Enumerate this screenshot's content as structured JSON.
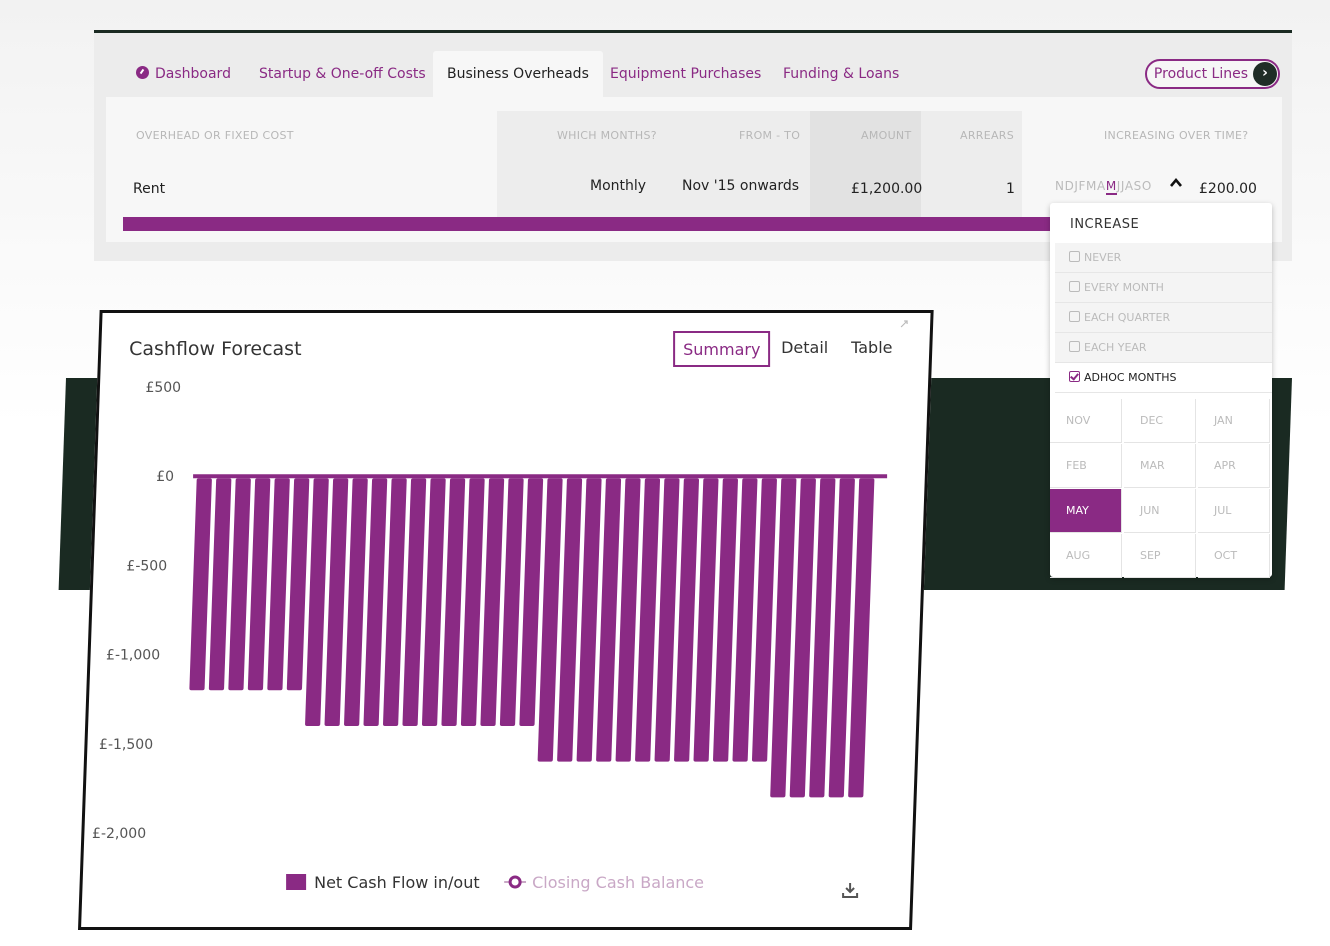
{
  "tabs": [
    {
      "label": "Dashboard",
      "icon": "dashboard-icon"
    },
    {
      "label": "Startup & One-off Costs"
    },
    {
      "label": "Business Overheads",
      "active": true
    },
    {
      "label": "Equipment Purchases"
    },
    {
      "label": "Funding & Loans"
    }
  ],
  "product_lines_label": "Product Lines",
  "table": {
    "headers": {
      "cost": "OVERHEAD OR FIXED COST",
      "which": "WHICH MONTHS?",
      "from_to": "FROM - TO",
      "amount": "AMOUNT",
      "arrears": "ARREARS",
      "increasing": "INCREASING OVER TIME?"
    },
    "row": {
      "name": "Rent",
      "which": "Monthly",
      "from_to": "Nov '15 onwards",
      "amount": "£1,200.00",
      "arrears": "1",
      "months_before": "NDJFMA",
      "months_selected": "M",
      "months_after": "JJASO",
      "increase_amount": "£200.00"
    }
  },
  "dropdown": {
    "title": "INCREASE",
    "options": [
      {
        "label": "NEVER",
        "checked": false
      },
      {
        "label": "EVERY MONTH",
        "checked": false
      },
      {
        "label": "EACH QUARTER",
        "checked": false
      },
      {
        "label": "EACH YEAR",
        "checked": false
      },
      {
        "label": "ADHOC MONTHS",
        "checked": true
      }
    ],
    "months": [
      "NOV",
      "DEC",
      "JAN",
      "FEB",
      "MAR",
      "APR",
      "MAY",
      "JUN",
      "JUL",
      "AUG",
      "SEP",
      "OCT"
    ],
    "selected_month": "MAY"
  },
  "chart": {
    "title": "Cashflow Forecast",
    "buttons": [
      "Summary",
      "Detail",
      "Table"
    ],
    "active_button": "Summary",
    "legend": {
      "net": "Net Cash Flow in/out",
      "closing": "Closing Cash Balance"
    }
  },
  "colors": {
    "accent": "#8a2a84",
    "dark": "#1a2a22",
    "closing_disabled": "#c9a8c6"
  },
  "chart_data": {
    "type": "bar",
    "title": "Cashflow Forecast",
    "yticks": [
      "£500",
      "£0",
      "£-500",
      "£-1,000",
      "£-1,500",
      "£-2,000"
    ],
    "ylim": [
      -2000,
      500
    ],
    "series": [
      {
        "name": "Net Cash Flow in/out",
        "values": [
          -1200,
          -1200,
          -1200,
          -1200,
          -1200,
          -1200,
          -1400,
          -1400,
          -1400,
          -1400,
          -1400,
          -1400,
          -1400,
          -1400,
          -1400,
          -1400,
          -1400,
          -1400,
          -1600,
          -1600,
          -1600,
          -1600,
          -1600,
          -1600,
          -1600,
          -1600,
          -1600,
          -1600,
          -1600,
          -1600,
          -1800,
          -1800,
          -1800,
          -1800,
          -1800
        ]
      },
      {
        "name": "Closing Cash Balance",
        "values": [],
        "hidden": true
      }
    ],
    "legend": "bottom",
    "grid": false
  }
}
